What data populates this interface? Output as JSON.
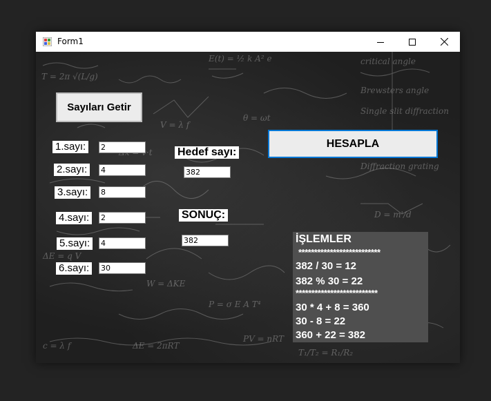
{
  "window": {
    "title": "Form1",
    "minimize_icon": "minimize-icon",
    "maximize_icon": "maximize-icon",
    "close_icon": "close-icon"
  },
  "buttons": {
    "get_numbers": "Sayıları Getir",
    "calculate": "HESAPLA"
  },
  "numbers": [
    {
      "label": "1.sayı:",
      "value": "2"
    },
    {
      "label": "2.sayı:",
      "value": "4"
    },
    {
      "label": "3.sayı:",
      "value": "8"
    },
    {
      "label": "4.sayı:",
      "value": "2"
    },
    {
      "label": "5.sayı:",
      "value": "4"
    },
    {
      "label": "6.sayı:",
      "value": "30"
    }
  ],
  "target": {
    "label": "Hedef sayı:",
    "value": "382"
  },
  "result": {
    "label": "SONUÇ:",
    "value": "382"
  },
  "operations": {
    "title": "İŞLEMLER",
    "separator1": "**************************",
    "line1": "382 / 30 = 12",
    "line2": "382 % 30 = 22",
    "separator2": "**************************",
    "line3": "30 * 4 + 8 = 360",
    "line4": "30 - 8 = 22",
    "line5": "360 + 22 = 382"
  }
}
